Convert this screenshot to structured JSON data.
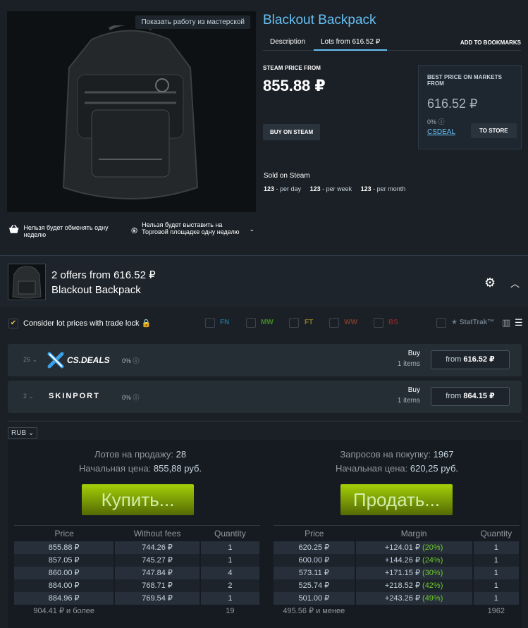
{
  "item": {
    "name": "Blackout Backpack",
    "workshop_button": "Показать работу из мастерской"
  },
  "tabs": [
    {
      "label": "Description"
    },
    {
      "label": "Lots from 616.52 ₽"
    }
  ],
  "bookmarks_label": "ADD TO BOOKMARKS",
  "steam_price": {
    "label": "STEAM PRICE FROM",
    "value": "855.88 ₽",
    "buy_button": "BUY ON STEAM"
  },
  "best_price": {
    "label": "BEST PRICE ON MARKETS FROM",
    "value": "616.52 ₽",
    "pct": "0%",
    "store_link": "CSDEAL",
    "store_button": "TO STORE"
  },
  "sold": {
    "title": "Sold on Steam",
    "per_day_count": "123",
    "per_day_label": " - per day",
    "per_week_count": "123",
    "per_week_label": " - per week",
    "per_month_count": "123",
    "per_month_label": " - per month"
  },
  "warnings": {
    "trade": "Нельзя будет обменять одну неделю",
    "market": "Нельзя будет выставить на Торговой площадке одну неделю"
  },
  "offers": {
    "title": "2 offers from 616.52 ₽",
    "subtitle": "Blackout Backpack"
  },
  "filters": {
    "trade_lock_label": "Consider lot prices with trade lock",
    "wear": [
      {
        "label": "FN",
        "color": "#1f6b8a"
      },
      {
        "label": "MW",
        "color": "#3f8a28"
      },
      {
        "label": "FT",
        "color": "#8a7a1f"
      },
      {
        "label": "WW",
        "color": "#7a3a2a"
      },
      {
        "label": "BS",
        "color": "#7a2a2a"
      }
    ],
    "stattrak": "StatTrak™"
  },
  "markets": [
    {
      "rank": "26",
      "name": "CS.DEALS",
      "pct": "0%",
      "buy": "Buy",
      "items": "1 items",
      "from_label": "from",
      "price": "616.52 ₽"
    },
    {
      "rank": "2",
      "name": "SKINPORT",
      "pct": "0%",
      "buy": "Buy",
      "items": "1 items",
      "from_label": "from",
      "price": "864.15 ₽"
    }
  ],
  "currency": "RUB",
  "steam_market": {
    "sell_count_label": "Лотов на продажу:",
    "sell_count": "28",
    "sell_start_label": "Начальная цена:",
    "sell_start": "855,88 руб.",
    "buy_count_label": "Запросов на покупку:",
    "buy_count": "1967",
    "buy_start_label": "Начальная цена:",
    "buy_start": "620,25 руб.",
    "buy_button": "Купить...",
    "sell_button": "Продать..."
  },
  "sell_table": {
    "headers": [
      "Price",
      "Without fees",
      "Quantity"
    ],
    "rows": [
      [
        "855.88 ₽",
        "744.26 ₽",
        "1"
      ],
      [
        "857.05 ₽",
        "745.27 ₽",
        "1"
      ],
      [
        "860.00 ₽",
        "747.84 ₽",
        "4"
      ],
      [
        "884.00 ₽",
        "768.71 ₽",
        "2"
      ],
      [
        "884.96 ₽",
        "769.54 ₽",
        "1"
      ]
    ],
    "footer": [
      "904.41 ₽ и более",
      "",
      "19"
    ]
  },
  "buy_table": {
    "headers": [
      "Price",
      "Margin",
      "Quantity"
    ],
    "rows": [
      [
        "620.25 ₽",
        "+124.01 ₽",
        "(20%)",
        "1"
      ],
      [
        "600.00 ₽",
        "+144.26 ₽",
        "(24%)",
        "1"
      ],
      [
        "573.11 ₽",
        "+171.15 ₽",
        "(30%)",
        "1"
      ],
      [
        "525.74 ₽",
        "+218.52 ₽",
        "(42%)",
        "1"
      ],
      [
        "501.00 ₽",
        "+243.26 ₽",
        "(49%)",
        "1"
      ]
    ],
    "footer": [
      "495.56 ₽ и менее",
      "",
      "1962"
    ]
  }
}
